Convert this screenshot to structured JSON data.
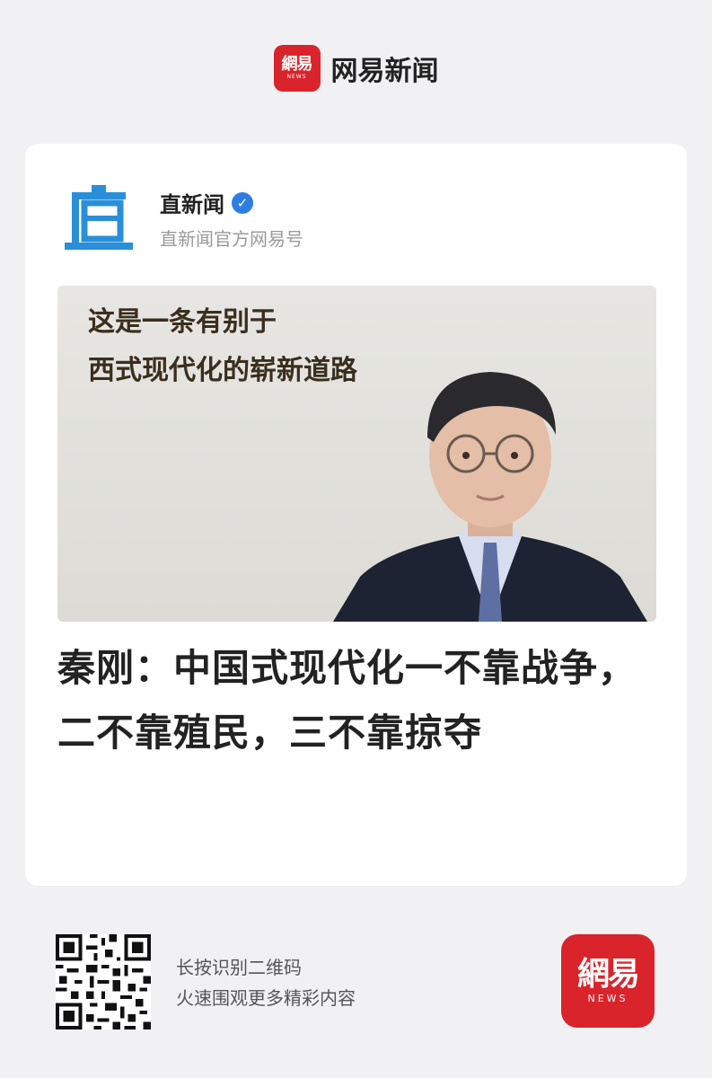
{
  "brand": {
    "logo_cn": "網易",
    "logo_en": "NEWS",
    "name": "网易新闻"
  },
  "publisher": {
    "name": "直新闻",
    "subtitle": "直新闻官方网易号",
    "icon_char": "直",
    "verified_mark": "✓"
  },
  "hero": {
    "caption_line1": "这是一条有别于",
    "caption_line2": "西式现代化的崭新道路"
  },
  "article": {
    "headline": "秦刚：中国式现代化一不靠战争，二不靠殖民，三不靠掠夺"
  },
  "footer": {
    "qr_line1": "长按识别二维码",
    "qr_line2": "火速围观更多精彩内容",
    "logo_cn": "網易",
    "logo_en": "NEWS"
  },
  "colors": {
    "brand_red": "#d9242b",
    "verified_blue": "#2f7de1",
    "publisher_icon_blue": "#2a8fd8"
  }
}
